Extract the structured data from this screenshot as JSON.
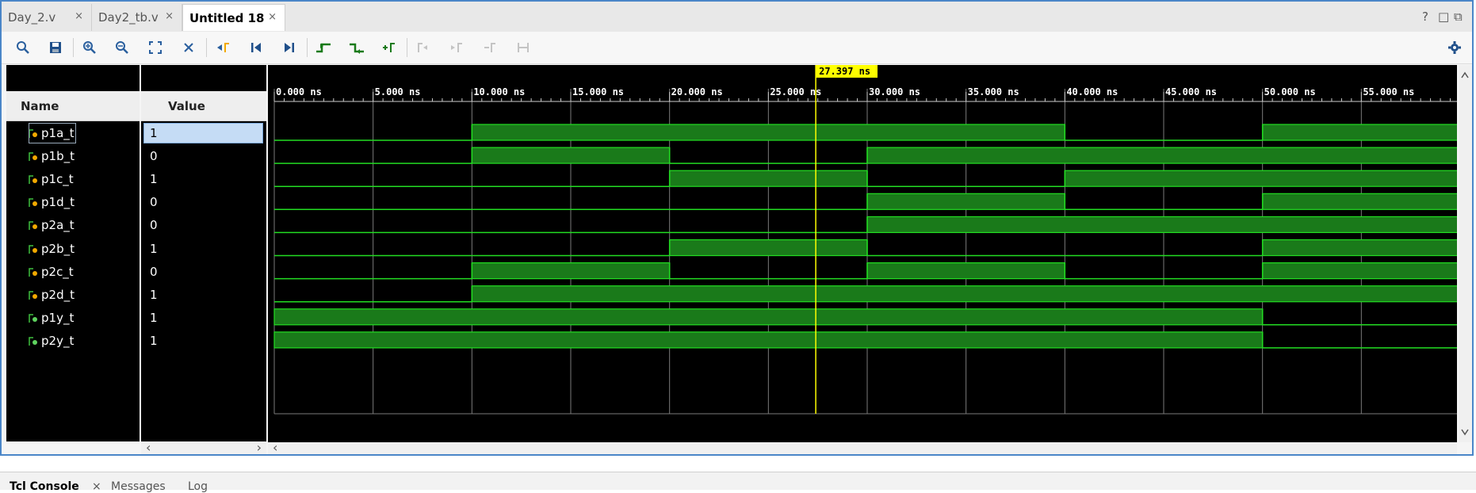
{
  "tabs": [
    {
      "label": "Day_2.v",
      "close": "×"
    },
    {
      "label": "Day2_tb.v",
      "close": "×"
    },
    {
      "label": "Untitled 18",
      "close": "×"
    }
  ],
  "window_controls": {
    "help": "?",
    "restore": "□",
    "maximize": "⧉"
  },
  "toolbar": {
    "icons": [
      "search-icon",
      "save-icon",
      "zoom-in-icon",
      "zoom-out-icon",
      "zoom-fit-icon",
      "cursor-icon",
      "go-to-marker-icon",
      "go-to-start-icon",
      "go-to-end-icon",
      "previous-transition-icon",
      "next-transition-icon",
      "add-marker-icon",
      "previous-marker-icon",
      "next-marker-icon",
      "swap-markers-icon",
      "marker-distance-icon"
    ],
    "settings_icon": "gear-icon"
  },
  "columns": {
    "name": "Name",
    "value": "Value"
  },
  "signals": [
    {
      "name": "p1a_t",
      "value": "1",
      "type": "input"
    },
    {
      "name": "p1b_t",
      "value": "0",
      "type": "input"
    },
    {
      "name": "p1c_t",
      "value": "1",
      "type": "input"
    },
    {
      "name": "p1d_t",
      "value": "0",
      "type": "input"
    },
    {
      "name": "p2a_t",
      "value": "0",
      "type": "input"
    },
    {
      "name": "p2b_t",
      "value": "1",
      "type": "input"
    },
    {
      "name": "p2c_t",
      "value": "0",
      "type": "input"
    },
    {
      "name": "p2d_t",
      "value": "1",
      "type": "input"
    },
    {
      "name": "p1y_t",
      "value": "1",
      "type": "output"
    },
    {
      "name": "p2y_t",
      "value": "1",
      "type": "output"
    }
  ],
  "timeline": {
    "ticks": [
      "0.000 ns",
      "5.000 ns",
      "10.000 ns",
      "15.000 ns",
      "20.000 ns",
      "25.000 ns",
      "30.000 ns",
      "35.000 ns",
      "40.000 ns",
      "45.000 ns",
      "50.000 ns",
      "55.000 ns"
    ],
    "range_ns": [
      0,
      60
    ],
    "cursor_ns": 27.397,
    "cursor_label": "27.397 ns"
  },
  "waveforms": {
    "p1a_t": [
      [
        0,
        10,
        0
      ],
      [
        10,
        40,
        1
      ],
      [
        40,
        50,
        0
      ],
      [
        50,
        60,
        1
      ]
    ],
    "p1b_t": [
      [
        0,
        10,
        0
      ],
      [
        10,
        20,
        1
      ],
      [
        20,
        30,
        0
      ],
      [
        30,
        60,
        1
      ]
    ],
    "p1c_t": [
      [
        0,
        20,
        0
      ],
      [
        20,
        30,
        1
      ],
      [
        30,
        40,
        0
      ],
      [
        40,
        60,
        1
      ]
    ],
    "p1d_t": [
      [
        0,
        30,
        0
      ],
      [
        30,
        40,
        1
      ],
      [
        40,
        50,
        0
      ],
      [
        50,
        60,
        1
      ]
    ],
    "p2a_t": [
      [
        0,
        30,
        0
      ],
      [
        30,
        60,
        1
      ]
    ],
    "p2b_t": [
      [
        0,
        20,
        0
      ],
      [
        20,
        30,
        1
      ],
      [
        30,
        50,
        0
      ],
      [
        50,
        60,
        1
      ]
    ],
    "p2c_t": [
      [
        0,
        10,
        0
      ],
      [
        10,
        20,
        1
      ],
      [
        20,
        30,
        0
      ],
      [
        30,
        40,
        1
      ],
      [
        40,
        50,
        0
      ],
      [
        50,
        60,
        1
      ]
    ],
    "p2d_t": [
      [
        0,
        10,
        0
      ],
      [
        10,
        60,
        1
      ]
    ],
    "p1y_t": [
      [
        0,
        50,
        1
      ],
      [
        50,
        60,
        0
      ]
    ],
    "p2y_t": [
      [
        0,
        50,
        1
      ],
      [
        50,
        60,
        0
      ]
    ]
  },
  "colors": {
    "wave": "#1a7a1a",
    "wave_line": "#22dd22",
    "cursor": "#ffff00",
    "grid": "#7a7a7a",
    "selection": "#c5dcf5"
  },
  "bottom_tabs": [
    {
      "label": "Tcl Console",
      "close": "×"
    },
    {
      "label": "Messages"
    },
    {
      "label": "Log"
    }
  ],
  "scroll_arrows": {
    "left": "‹",
    "right": "›"
  }
}
